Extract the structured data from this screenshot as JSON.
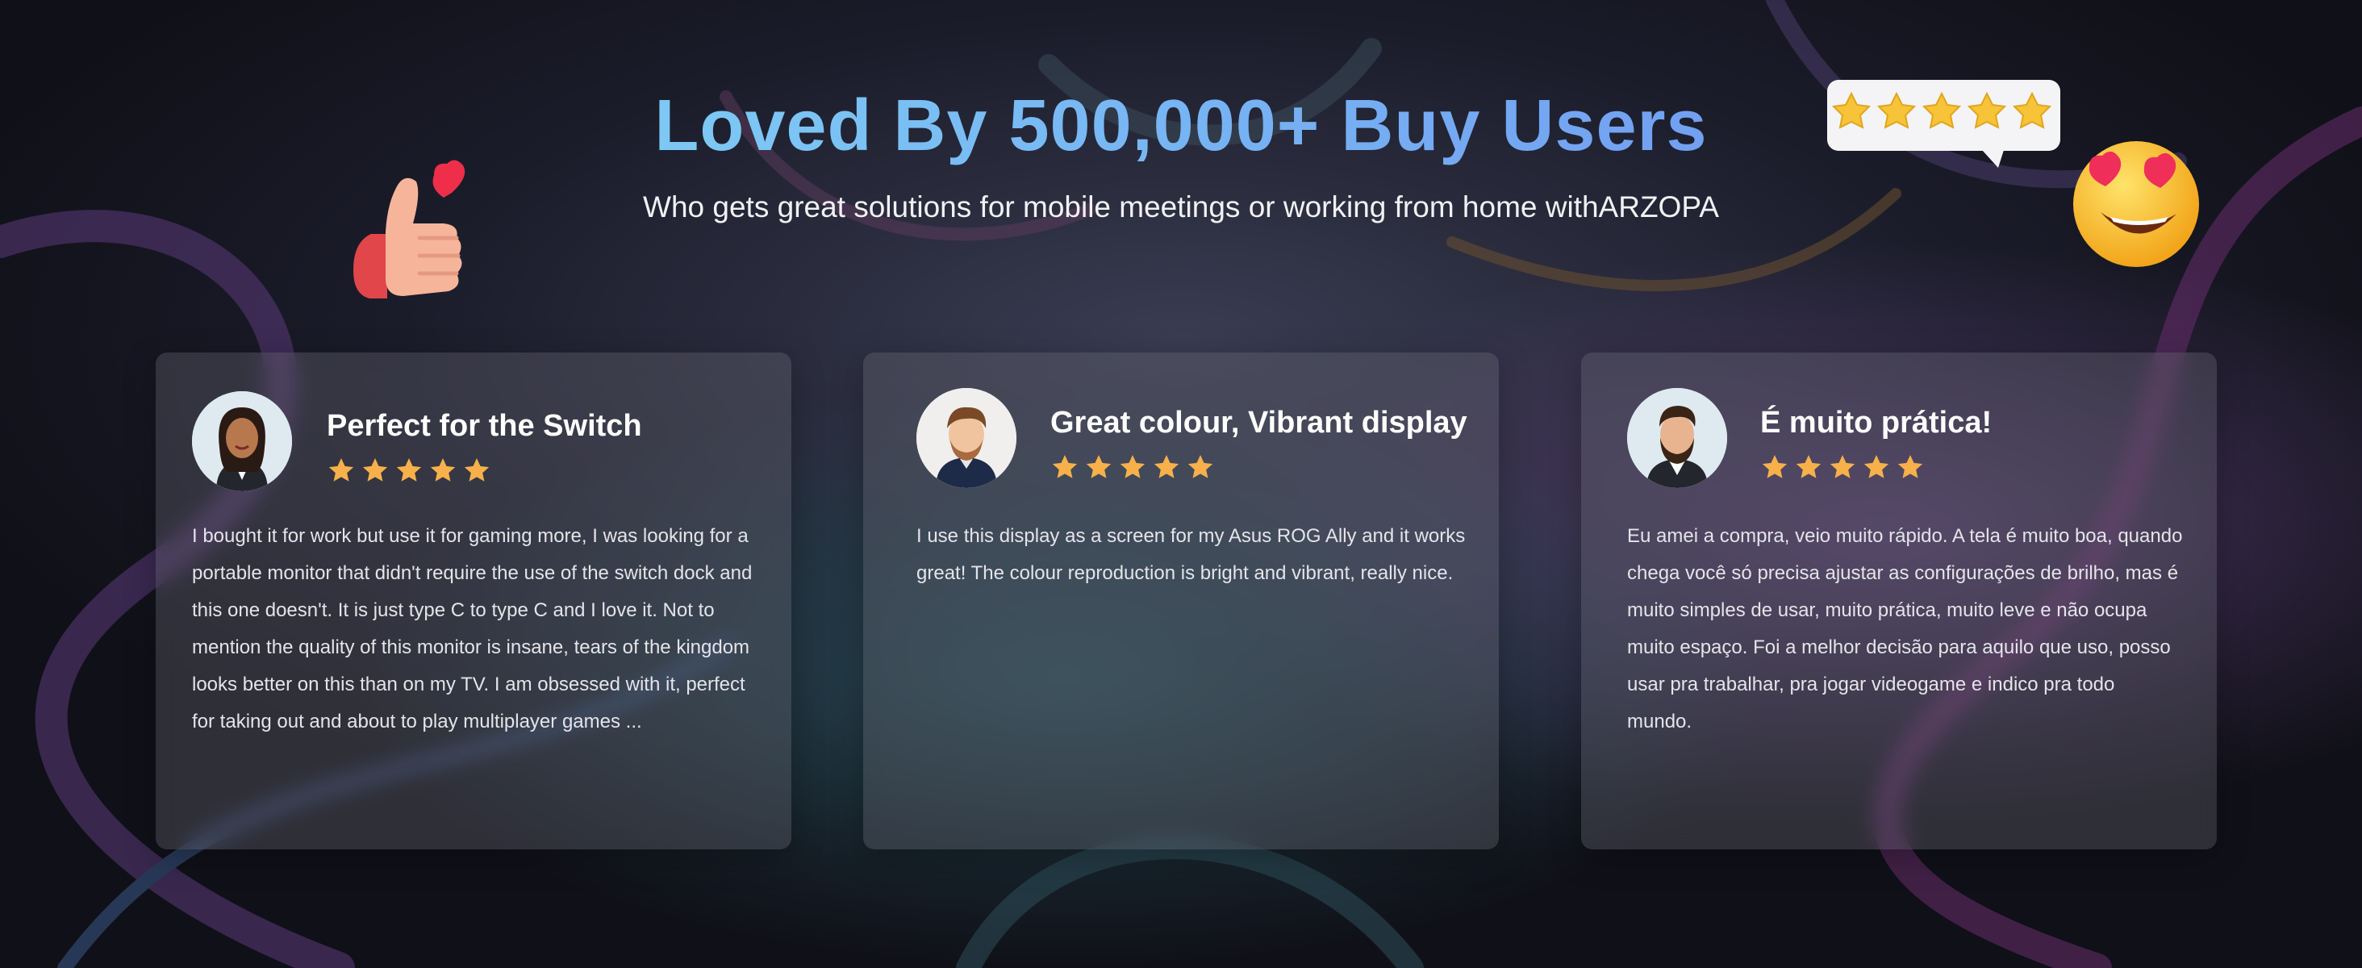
{
  "heading": {
    "title": "Loved By 500,000+ Buy Users",
    "subtitle": "Who gets great solutions for mobile meetings or working from home withARZOPA"
  },
  "colors": {
    "title_gradient": [
      "#86e3f2",
      "#78b9f4",
      "#6d86ee"
    ],
    "star": "#f7b04a",
    "card_bg": "rgba(108,108,120,0.34)"
  },
  "decorations": [
    "thumbs-up-heart-icon",
    "five-star-speech-bubble-icon",
    "heart-eyes-emoji-icon"
  ],
  "reviews": [
    {
      "avatar": "woman-avatar",
      "title": "Perfect for the Switch",
      "rating": 5,
      "text": "I bought it for work but use it for gaming more, I was looking for a portable monitor that didn't require the use of the switch dock and this one doesn't. It is just type C to type C and I love it. Not to mention the quality of this monitor is insane, tears of the kingdom looks better on this than on my TV. I am obsessed with it, perfect for taking out and about to play multiplayer games ..."
    },
    {
      "avatar": "man-avatar",
      "title": "Great colour, Vibrant display",
      "rating": 5,
      "text": "I use this display as a screen for my Asus ROG Ally and it works great! The colour reproduction is bright and vibrant, really nice."
    },
    {
      "avatar": "bearded-man-avatar",
      "title": "É muito prática!",
      "rating": 5,
      "text": "Eu amei a compra, veio muito rápido. A tela é muito boa, quando chega você só precisa ajustar as configurações de brilho, mas é muito simples de usar, muito prática, muito leve e não ocupa muito espaço. Foi a melhor decisão para aquilo que uso, posso usar pra trabalhar, pra jogar videogame e indico pra todo mundo."
    }
  ]
}
